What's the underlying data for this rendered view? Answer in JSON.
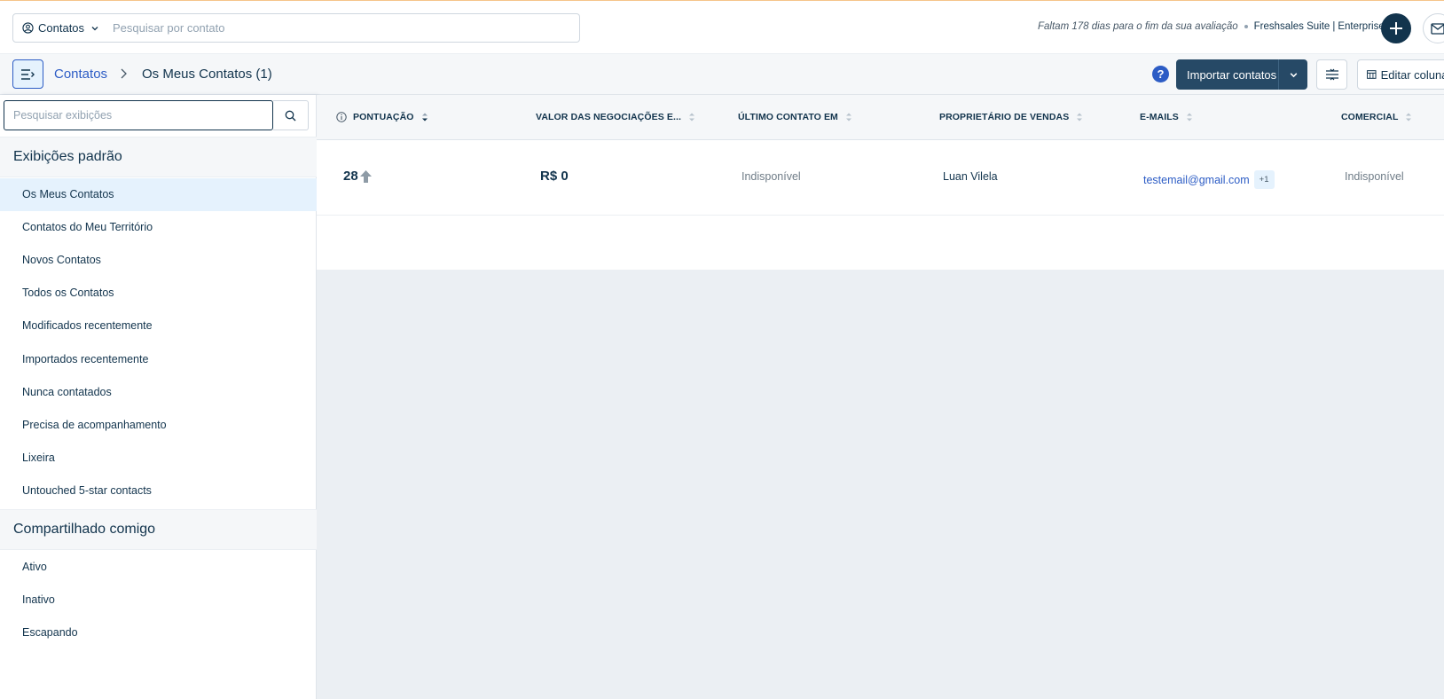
{
  "topbar": {
    "entity_select": "Contatos",
    "search_placeholder": "Pesquisar por contato",
    "trial_days": "Faltam 178 dias para o fim da sua avaliação",
    "product": "Freshsales Suite",
    "plan_separator": "|",
    "plan": "Enterprise"
  },
  "header": {
    "breadcrumb_link": "Contatos",
    "current_view": "Os Meus Contatos (1)",
    "help": "?",
    "import_label": "Importar contatos",
    "edit_columns_label": "Editar colunas"
  },
  "sidebar": {
    "search_placeholder": "Pesquisar exibições",
    "default_section": "Exibições padrão",
    "default_views": [
      "Os Meus Contatos",
      "Contatos do Meu Território",
      "Novos Contatos",
      "Todos os Contatos",
      "Modificados recentemente",
      "Importados recentemente",
      "Nunca contatados",
      "Precisa de acompanhamento",
      "Lixeira",
      "Untouched 5-star contacts"
    ],
    "shared_section": "Compartilhado comigo",
    "shared_views": [
      "Ativo",
      "Inativo",
      "Escapando"
    ]
  },
  "table": {
    "columns": [
      "PONTUAÇÃO",
      "VALOR DAS NEGOCIAÇÕES E...",
      "ÚLTIMO CONTATO EM",
      "PROPRIETÁRIO DE VENDAS",
      "E-MAILS",
      "COMERCIAL"
    ],
    "rows": [
      {
        "score": "28",
        "deal_value": "R$ 0",
        "last_contacted": "Indisponível",
        "owner": "Luan Vilela",
        "email": "testemail@gmail.com",
        "email_extra": "+1",
        "work": "Indisponível"
      }
    ]
  },
  "colors": {
    "primary_dark": "#12344d",
    "button_dark": "#264966",
    "link_blue": "#2c5cc5",
    "active_bg": "#e5f2fd",
    "panel_bg": "#ebeff3"
  }
}
